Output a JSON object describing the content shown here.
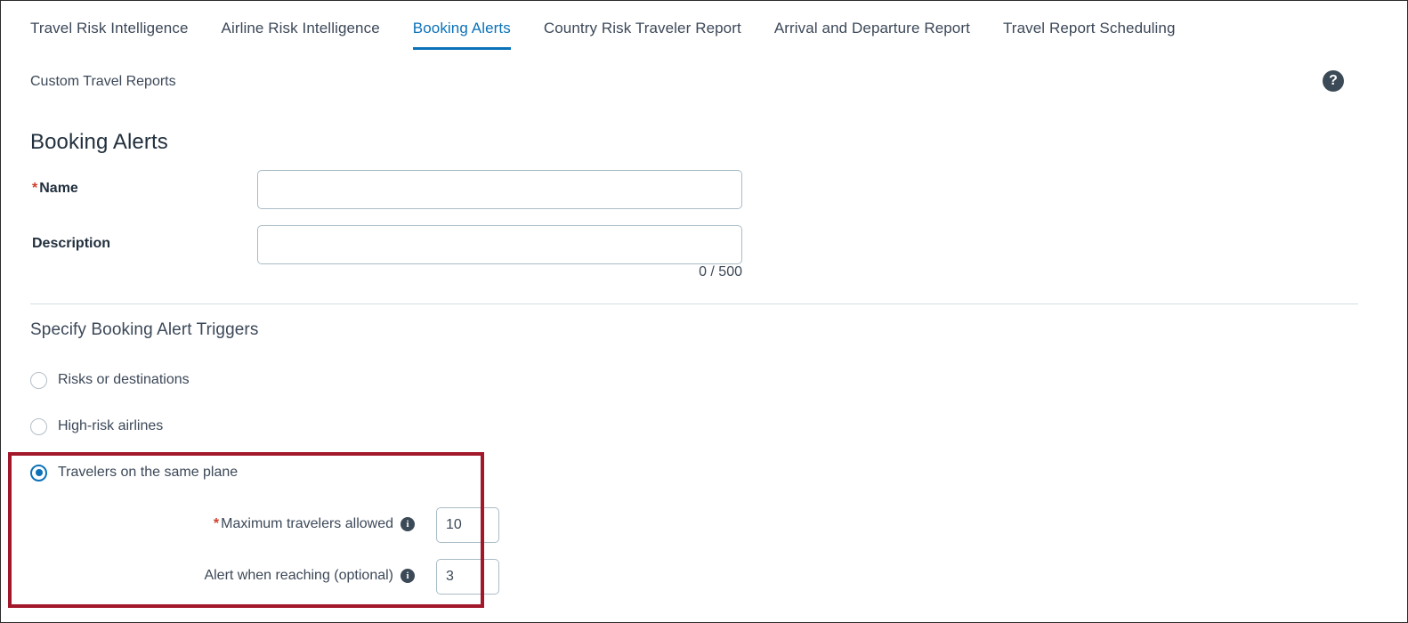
{
  "tabs": [
    {
      "label": "Travel Risk Intelligence",
      "active": false
    },
    {
      "label": "Airline Risk Intelligence",
      "active": false
    },
    {
      "label": "Booking Alerts",
      "active": true
    },
    {
      "label": "Country Risk Traveler Report",
      "active": false
    },
    {
      "label": "Arrival and Departure Report",
      "active": false
    },
    {
      "label": "Travel Report Scheduling",
      "active": false
    }
  ],
  "breadcrumb": {
    "label": "Custom Travel Reports",
    "help_icon": "help-circle-icon",
    "help_glyph": "?"
  },
  "page_title": "Booking Alerts",
  "form": {
    "name": {
      "label": "Name",
      "required": true,
      "required_marker": "*",
      "value": "",
      "placeholder": ""
    },
    "description": {
      "label": "Description",
      "required": false,
      "value": "",
      "placeholder": "",
      "char_counter": "0 / 500"
    }
  },
  "triggers": {
    "section_title": "Specify Booking Alert Triggers",
    "options": [
      {
        "label": "Risks or destinations",
        "selected": false
      },
      {
        "label": "High-risk airlines",
        "selected": false
      },
      {
        "label": "Travelers on the same plane",
        "selected": true
      }
    ],
    "same_plane_fields": [
      {
        "label": "Maximum travelers allowed",
        "required": true,
        "required_marker": "*",
        "info_icon": "info-circle-icon",
        "info_glyph": "i",
        "value": "10"
      },
      {
        "label": "Alert when reaching (optional)",
        "required": false,
        "required_marker": "",
        "info_icon": "info-circle-icon",
        "info_glyph": "i",
        "value": "3"
      }
    ]
  },
  "colors": {
    "accent_blue": "#0b72b9",
    "text_dark": "#22303e",
    "text_body": "#3c4858",
    "required_red": "#d0402a",
    "highlight_red": "#a21729",
    "input_border": "#a9bcc6",
    "divider": "#d6dde2",
    "icon_dark": "#3b4a56"
  }
}
